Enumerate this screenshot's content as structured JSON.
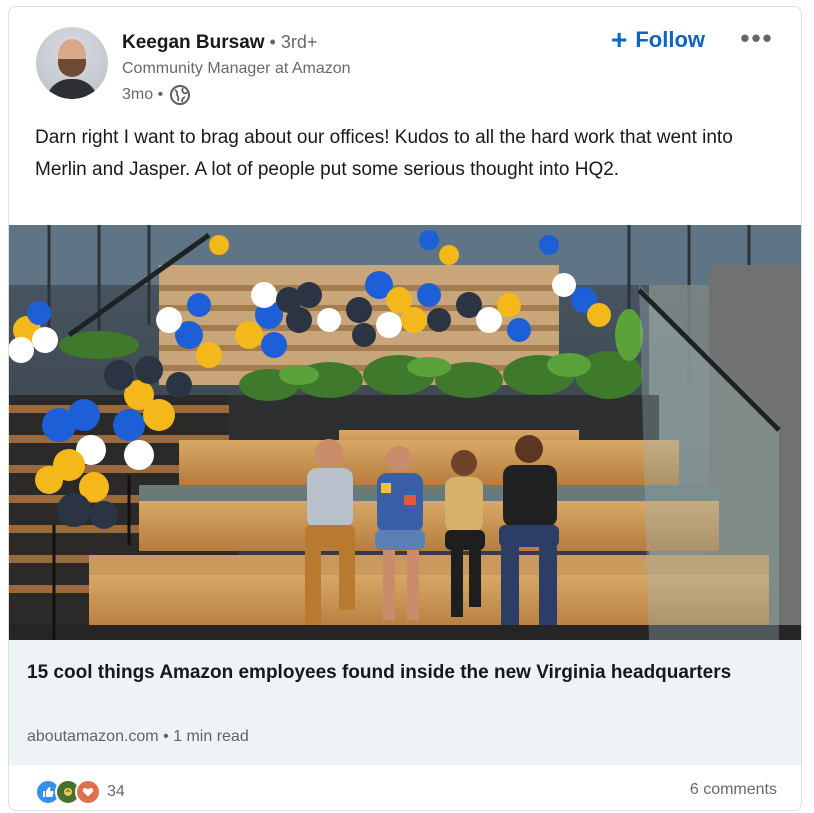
{
  "author": {
    "name": "Keegan Bursaw",
    "degree": " • 3rd+",
    "headline": "Community Manager at Amazon",
    "time": "3mo •",
    "visibility_icon": "globe-icon"
  },
  "actions": {
    "follow_label": "Follow",
    "follow_icon": "plus-icon",
    "more_icon": "more-dots-icon"
  },
  "post": {
    "text": "Darn right I want to brag about our offices! Kudos to all the hard work that went into Merlin and Jasper. A lot of people put some serious thought into HQ2."
  },
  "link_preview": {
    "title": "15 cool things Amazon employees found inside the new Virginia headquarters",
    "meta": "aboutamazon.com • 1 min read"
  },
  "social": {
    "reaction_icons": [
      "like-icon",
      "celebrate-icon",
      "love-icon"
    ],
    "reaction_count": "34",
    "comments": "6 comments"
  },
  "colors": {
    "accent": "#0a66c2",
    "link_bg": "#eef3f8",
    "balloon_blue": "#1d5fd6",
    "balloon_yellow": "#f5b81b",
    "balloon_navy": "#2a3442"
  }
}
